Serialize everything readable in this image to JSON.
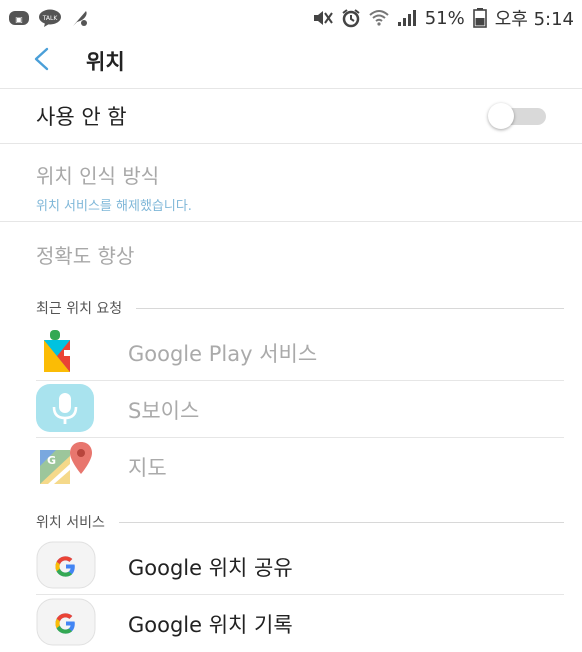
{
  "status_bar": {
    "battery": "51%",
    "time": "오후 5:14",
    "left_icons": [
      "line-icon",
      "kakaotalk-icon",
      "feather-icon"
    ],
    "right_icons": [
      "mute-icon",
      "alarm-icon",
      "wifi-icon",
      "signal-icon",
      "battery-icon"
    ]
  },
  "header": {
    "title": "위치"
  },
  "master": {
    "label": "사용 안 함",
    "enabled": false
  },
  "method": {
    "title": "위치 인식 방식",
    "subtitle": "위치 서비스를 해제했습니다."
  },
  "accuracy": {
    "title": "정확도 향상"
  },
  "recent_requests": {
    "header": "최근 위치 요청",
    "items": [
      {
        "label": "Google Play 서비스",
        "icon": "google-play-services-icon"
      },
      {
        "label": "S보이스",
        "icon": "s-voice-icon"
      },
      {
        "label": "지도",
        "icon": "google-maps-icon"
      }
    ]
  },
  "location_services": {
    "header": "위치 서비스",
    "items": [
      {
        "label": "Google 위치 공유",
        "icon": "google-icon"
      },
      {
        "label": "Google 위치 기록",
        "icon": "google-icon"
      }
    ]
  },
  "colors": {
    "accent": "#4a9fd8",
    "disabled_text": "#a8a8a8",
    "subtitle": "#7fb7d8"
  }
}
